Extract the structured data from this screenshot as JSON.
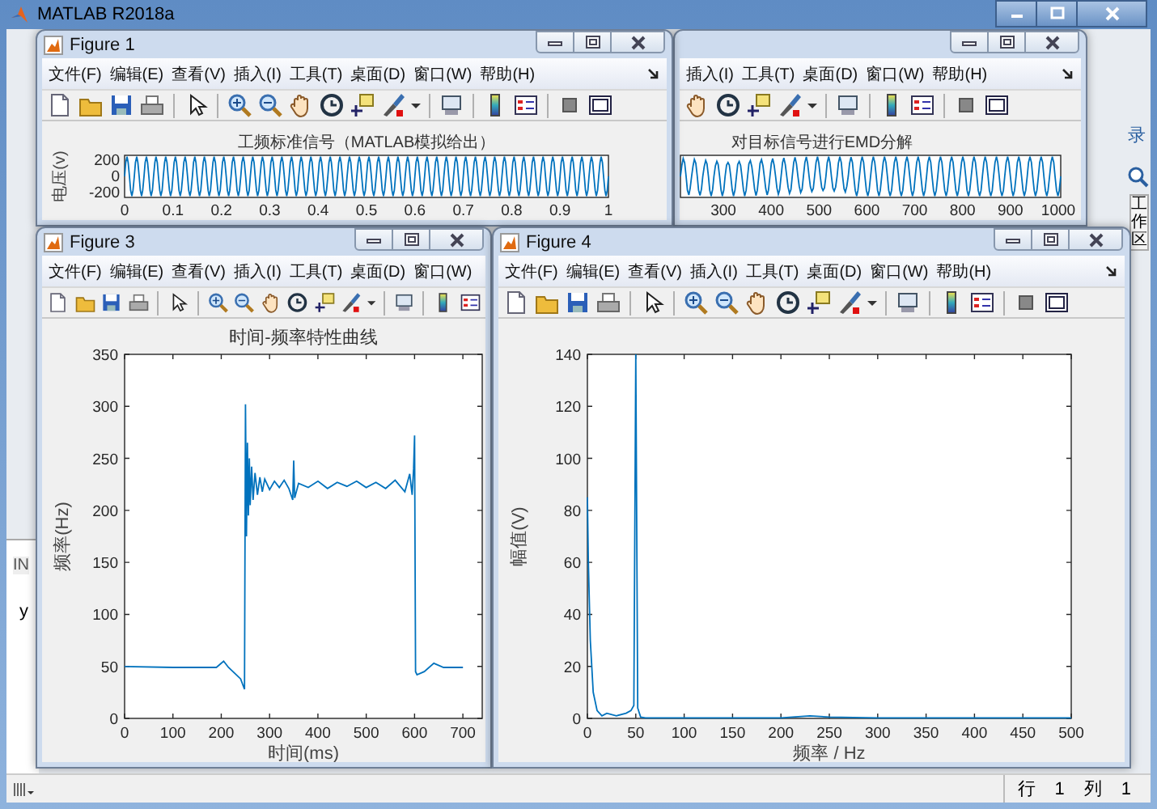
{
  "main_window": {
    "title": "MATLAB R2018a",
    "left_panel": {
      "header": "IN",
      "line": "y"
    },
    "right_panel": {
      "corner_text": "录",
      "vertical_label": "工作区"
    },
    "status_bar": {
      "row_label": "行",
      "row": "1",
      "col_label": "列",
      "col": "1"
    }
  },
  "figures": [
    {
      "title": "Figure 1",
      "menu": [
        "文件(F)",
        "编辑(E)",
        "查看(V)",
        "插入(I)",
        "工具(T)",
        "桌面(D)",
        "窗口(W)",
        "帮助(H)"
      ],
      "toolbar": {
        "kind": "full"
      },
      "plot": {
        "kind": "wave",
        "title": "工频标准信号（MATLAB模拟给出）",
        "ylabel": "电压(v)",
        "y_tick_labels": [
          "200",
          "0",
          "-200"
        ],
        "x_tick_labels": [
          "0",
          "0.1",
          "0.2",
          "0.3",
          "0.4",
          "0.5",
          "0.6",
          "0.7",
          "0.8",
          "0.9",
          "1"
        ]
      }
    },
    {
      "menu": [
        "插入(I)",
        "工具(T)",
        "桌面(D)",
        "窗口(W)",
        "帮助(H)"
      ],
      "toolbar": {
        "kind": "right"
      },
      "plot": {
        "kind": "wave",
        "title": "对目标信号进行EMD分解",
        "x_tick_labels": [
          "300",
          "400",
          "500",
          "600",
          "700",
          "800",
          "900",
          "1000"
        ]
      }
    },
    {
      "title": "Figure 3",
      "menu": [
        "文件(F)",
        "编辑(E)",
        "查看(V)",
        "插入(I)",
        "工具(T)",
        "桌面(D)",
        "窗口(W)"
      ],
      "toolbar": {
        "kind": "left"
      },
      "plot": {
        "kind": "chart",
        "chart_data": {
          "type": "line",
          "title": "时间-频率特性曲线",
          "xlabel": "时间(ms)",
          "ylabel": "频率(Hz)",
          "x": [
            0,
            100,
            190,
            205,
            215,
            240,
            248,
            250,
            252,
            254,
            256,
            258,
            260,
            263,
            266,
            270,
            275,
            280,
            285,
            290,
            300,
            310,
            320,
            330,
            340,
            348,
            350,
            352,
            360,
            380,
            400,
            420,
            440,
            460,
            480,
            500,
            520,
            540,
            560,
            580,
            590,
            595,
            598,
            600,
            602,
            605,
            620,
            640,
            660,
            700
          ],
          "series": [
            {
              "color": "#0072bd",
              "values": [
                50,
                49,
                49,
                55,
                49,
                38,
                28,
                302,
                175,
                265,
                195,
                250,
                205,
                242,
                210,
                236,
                215,
                232,
                218,
                230,
                220,
                228,
                222,
                229,
                221,
                210,
                248,
                212,
                226,
                222,
                228,
                221,
                227,
                223,
                228,
                222,
                227,
                221,
                229,
                218,
                235,
                215,
                240,
                272,
                45,
                42,
                45,
                53,
                49,
                49
              ]
            }
          ],
          "xlim": [
            0,
            740
          ],
          "ylim": [
            0,
            350
          ],
          "xticks": [
            0,
            100,
            200,
            300,
            400,
            500,
            600,
            700
          ],
          "yticks": [
            0,
            50,
            100,
            150,
            200,
            250,
            300,
            350
          ]
        }
      }
    },
    {
      "title": "Figure 4",
      "menu": [
        "文件(F)",
        "编辑(E)",
        "查看(V)",
        "插入(I)",
        "工具(T)",
        "桌面(D)",
        "窗口(W)",
        "帮助(H)"
      ],
      "toolbar": {
        "kind": "full"
      },
      "plot": {
        "kind": "chart",
        "chart_data": {
          "type": "line",
          "xlabel": "频率 / Hz",
          "ylabel": "幅值(V)",
          "x": [
            0,
            1,
            3,
            6,
            10,
            15,
            20,
            30,
            40,
            45,
            48,
            50,
            52,
            55,
            60,
            100,
            200,
            230,
            250,
            300,
            400,
            500
          ],
          "series": [
            {
              "color": "#0072bd",
              "values": [
                85,
                60,
                30,
                10,
                3,
                1,
                2,
                1,
                2,
                3,
                5,
                140,
                4,
                0.5,
                0.2,
                0.2,
                0.2,
                1,
                0.5,
                0.2,
                0.2,
                0.2
              ]
            }
          ],
          "xlim": [
            0,
            500
          ],
          "ylim": [
            0,
            140
          ],
          "xticks": [
            0,
            50,
            100,
            150,
            200,
            250,
            300,
            350,
            400,
            450,
            500
          ],
          "yticks": [
            0,
            20,
            40,
            60,
            80,
            100,
            120,
            140
          ]
        }
      }
    }
  ]
}
